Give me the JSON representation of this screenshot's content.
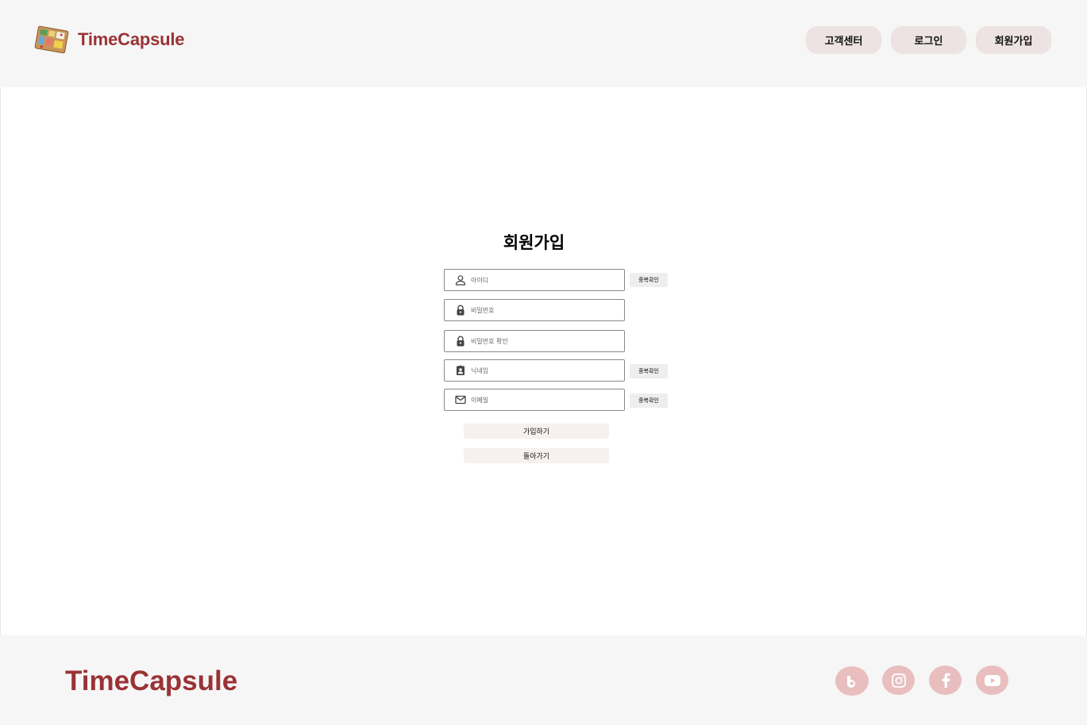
{
  "header": {
    "logo_text": "TimeCapsule",
    "nav": {
      "customer_center": "고객센터",
      "login": "로그인",
      "signup": "회원가입"
    }
  },
  "form": {
    "title": "회원가입",
    "fields": {
      "id_placeholder": "아이디",
      "password_placeholder": "비밀번호",
      "password_confirm_placeholder": "비밀번호 확인",
      "nickname_placeholder": "닉네임",
      "email_placeholder": "이메일"
    },
    "duplicate_check_label": "중복확인",
    "submit_label": "가입하기",
    "back_label": "돌아가기"
  },
  "footer": {
    "logo_text": "TimeCapsule",
    "social_icons": [
      "blog-icon",
      "instagram-icon",
      "facebook-icon",
      "youtube-icon"
    ]
  },
  "colors": {
    "brand": "#9b3235",
    "nav_button_bg": "#ece3e2",
    "social_bg": "#e8bebe",
    "bar_bg": "#f6f6f6"
  }
}
